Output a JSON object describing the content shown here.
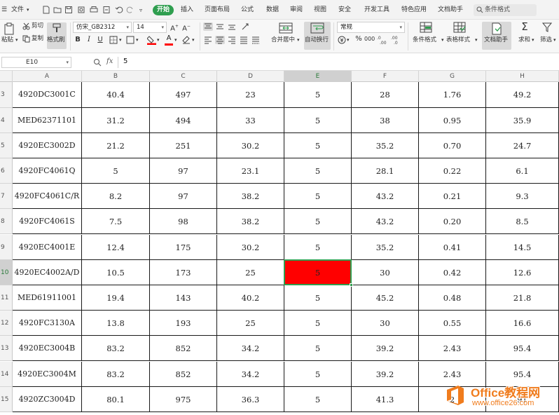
{
  "menubar": {
    "file_label": "文件",
    "tabs": [
      "开始",
      "插入",
      "页面布局",
      "公式",
      "数据",
      "审阅",
      "视图",
      "安全",
      "开发工具",
      "特色应用",
      "文档助手"
    ],
    "active_tab": "开始",
    "search_placeholder": "条件格式"
  },
  "ribbon": {
    "paste_label": "粘贴",
    "cut_label": "剪切",
    "copy_label": "复制",
    "format_painter_label": "格式刷",
    "font_name": "仿宋_GB2312",
    "font_size": "14",
    "merge_label": "合并居中",
    "wrap_label": "自动换行",
    "number_format": "常规",
    "conditional_format_label": "条件格式",
    "table_style_label": "表格样式",
    "doc_assistant_label": "文档助手",
    "sum_label": "求和",
    "filter_label": "筛选"
  },
  "formula_bar": {
    "cell_ref": "E10",
    "fx": "fx",
    "value": "5"
  },
  "sheet": {
    "columns": [
      "A",
      "B",
      "C",
      "D",
      "E",
      "F",
      "G",
      "H"
    ],
    "active_column": "E",
    "active_row": "10",
    "rows": [
      {
        "row": "3",
        "cells": [
          "4920DC3001C",
          "40.4",
          "497",
          "23",
          "5",
          "28",
          "1.76",
          "49.2"
        ]
      },
      {
        "row": "4",
        "cells": [
          "MED62371101",
          "31.2",
          "494",
          "33",
          "5",
          "38",
          "0.95",
          "35.9"
        ]
      },
      {
        "row": "5",
        "cells": [
          "4920EC3002D",
          "21.2",
          "251",
          "30.2",
          "5",
          "35.2",
          "0.70",
          "24.7"
        ]
      },
      {
        "row": "6",
        "cells": [
          "4920FC4061Q",
          "5",
          "97",
          "23.1",
          "5",
          "28.1",
          "0.22",
          "6.1"
        ]
      },
      {
        "row": "7",
        "cells": [
          "4920FC4061C/R",
          "8.2",
          "97",
          "38.2",
          "5",
          "43.2",
          "0.21",
          "9.3"
        ]
      },
      {
        "row": "8",
        "cells": [
          "4920FC4061S",
          "7.5",
          "98",
          "38.2",
          "5",
          "43.2",
          "0.20",
          "8.5"
        ]
      },
      {
        "row": "9",
        "cells": [
          "4920EC4001E",
          "12.4",
          "175",
          "30.2",
          "5",
          "35.2",
          "0.41",
          "14.5"
        ]
      },
      {
        "row": "10",
        "cells": [
          "4920EC4002A/D",
          "10.5",
          "173",
          "25",
          "5",
          "30",
          "0.42",
          "12.6"
        ]
      },
      {
        "row": "11",
        "cells": [
          "MED61911001",
          "19.4",
          "143",
          "40.2",
          "5",
          "45.2",
          "0.48",
          "21.8"
        ]
      },
      {
        "row": "12",
        "cells": [
          "4920FC3130A",
          "13.8",
          "193",
          "25",
          "5",
          "30",
          "0.55",
          "16.6"
        ]
      },
      {
        "row": "13",
        "cells": [
          "4920EC3004B",
          "83.2",
          "852",
          "34.2",
          "5",
          "39.2",
          "2.43",
          "95.4"
        ]
      },
      {
        "row": "14",
        "cells": [
          "4920EC3004M",
          "83.2",
          "852",
          "34.2",
          "5",
          "39.2",
          "2.43",
          "95.4"
        ]
      },
      {
        "row": "15",
        "cells": [
          "4920ZC3004D",
          "80.1",
          "975",
          "36.3",
          "5",
          "41.3",
          "2",
          "91"
        ]
      }
    ],
    "highlight_color": "#ff0000",
    "selection_color": "#2f9e4f"
  },
  "watermark": {
    "title": "Office教程网",
    "url": "www.office26.com"
  }
}
